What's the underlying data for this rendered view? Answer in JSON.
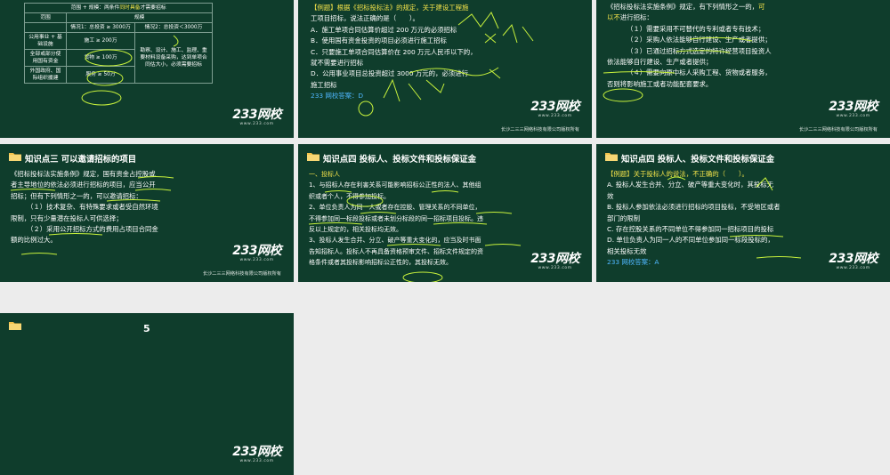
{
  "brand": {
    "logo": "233网校",
    "logo_sub": "www.233.com",
    "copyright": "长沙二三三网络科技有限公司版权所有"
  },
  "colors": {
    "slide_bg": "#0f3d2c",
    "highlight": "#f4e34a",
    "answer": "#4fb7ff",
    "ink": "#c8f23c"
  },
  "slide1": {
    "table": {
      "r1": [
        "范围 + 规模：两条件",
        "同时具备",
        "才需要招标"
      ],
      "r2": [
        "范围",
        "规模"
      ],
      "r3": [
        "情况1：总投资 ≥ 3000万",
        "情况2：总投资＜3000万"
      ],
      "r4": [
        "公用事业 + 基础设施",
        "施工 ≥ 200万"
      ],
      "r5": [
        "全部或部分使用国有资金",
        "货物 ≥ 100万",
        "勘察、设计、施工、监理、重要材料设备采购，达到单项合同估大小，必须需要招标"
      ],
      "r6": [
        "外国政府、国际组织援建",
        "服务 ≥ 50万"
      ]
    }
  },
  "slide2": {
    "lines": [
      "【例题】根据《招标投标法》的规定，关于建设工程施",
      "工项目招标，说法正确的是（　　）。",
      "A．施工单项合同估算价超过 200 万元的必须招标",
      "B．使用国有资金投资的项目必须进行施工招标",
      "C．只要施工单项合同估算价在 200 万元人民币以下的，",
      "就不需要进行招标",
      "D．公用事业项目总投资超过 3000 万元的，必须进行",
      "施工招标"
    ],
    "answer": "233 网校答案：D",
    "copyright": "长沙二三三网络科技有限公司版权所有"
  },
  "slide3": {
    "l1a": "《招标投标法实施条例》规定，有下列情形之一的，",
    "l1b": "可",
    "l2": "以不",
    "l2b": "进行招标：",
    "items": [
      "（１）需要采用不可替代的专利或者专有技术；",
      "（２）采购人依法能够自行建设、生产或者提供；",
      "（３）已通过招标方式选定的特许经营项目投资人",
      "依法能够自行建设、生产或者提供；",
      "（４）需要向原中标人采购工程、货物或者服务，",
      "否则将影响施工或者功能配套要求。"
    ]
  },
  "slide4": {
    "title": "知识点三 可以邀请招标的项目",
    "lines": [
      "《招标投标法实施条例》规定，国有资金占控股或",
      "者主导地位的依法必须进行招标的项目，应当公开",
      "招标；但有下列情形之一的，可以邀请招标：",
      "（１）技术复杂、有特殊要求或者受自然环境",
      "限制，只有少量潜在投标人可供选择；",
      "（２）采用公开招标方式的费用占项目合同金",
      "额的比例过大。"
    ],
    "copyright": "长沙二三三网络科技有限公司版权所有"
  },
  "slide5": {
    "title": "知识点四 投标人、投标文件和投标保证金",
    "heading": "一、投标人",
    "lines": [
      "1、与招标人存在利害关系可能影响招标公正性的法人、其他组",
      "织或者个人，不得参加投标。",
      "2、单位负责人为同一人或者存在控股、管理关系的不同单位，",
      "不得参加同一标段投标或者未划分标段的同一招标项目投标。违",
      "反以上规定的，相关投标均无效。",
      "3、投标人发生合并、分立、破产等重大变化的，应当及时书面",
      "告知招标人。投标人不再具备资格预审文件、招标文件规定的资",
      "格条件或者其投标影响招标公正性的，其投标无效。"
    ]
  },
  "slide6": {
    "title": "知识点四 投标人、投标文件和投标保证金",
    "lines": [
      "【例题】关于投标人的说法，不正确的（　　）。",
      "A. 投标人发生合并、分立、破产等重大变化时，其投标无",
      "效",
      "B. 投标人参加依法必须进行招标的项目投标，不受地区或者",
      "部门的限制",
      "C. 存在控股关系的不同单位不得参加同一招标项目的投标",
      "D. 单位负责人为同一人的不同单位参加同一标段投标的，",
      "相关投标无效"
    ],
    "answer": "233 网校答案：A"
  },
  "slide7": {
    "number": "5"
  }
}
